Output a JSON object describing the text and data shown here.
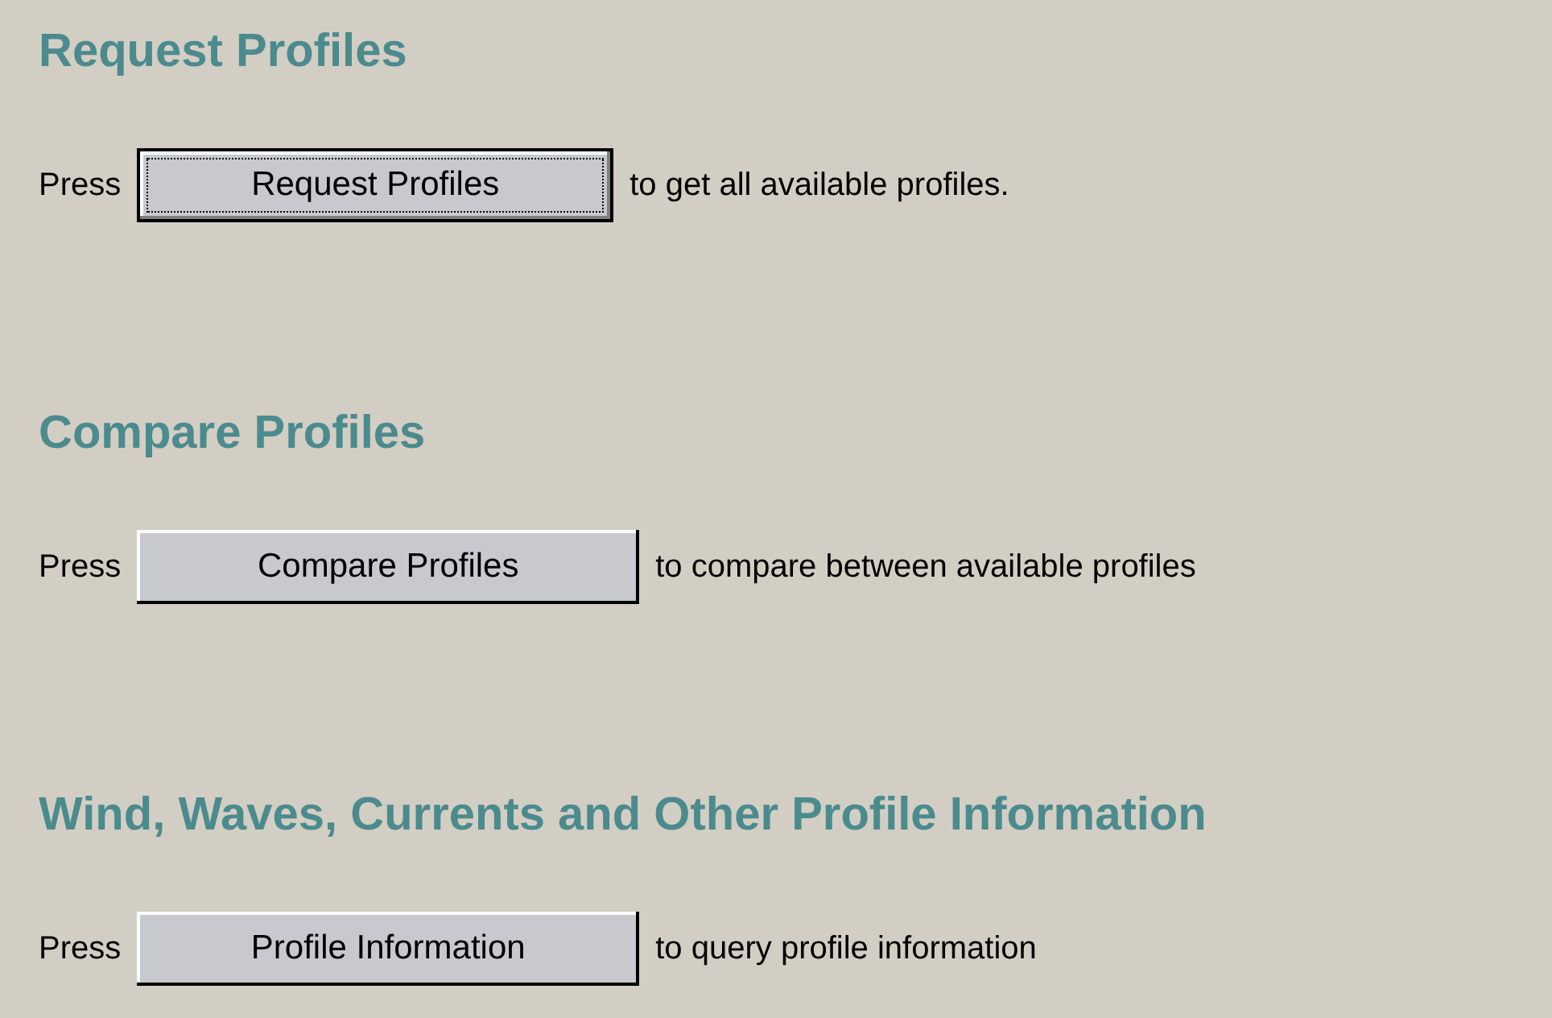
{
  "sections": [
    {
      "heading": "Request Profiles",
      "prefix": "Press",
      "button": {
        "label": "Request Profiles",
        "focused": true
      },
      "suffix": "to get all available profiles."
    },
    {
      "heading": "Compare Profiles",
      "prefix": "Press",
      "button": {
        "label": "Compare Profiles",
        "focused": false
      },
      "suffix": "to compare between available profiles"
    },
    {
      "heading": "Wind, Waves, Currents and Other Profile Information",
      "prefix": "Press",
      "button": {
        "label": "Profile Information",
        "focused": false
      },
      "suffix": "to query profile information"
    }
  ]
}
